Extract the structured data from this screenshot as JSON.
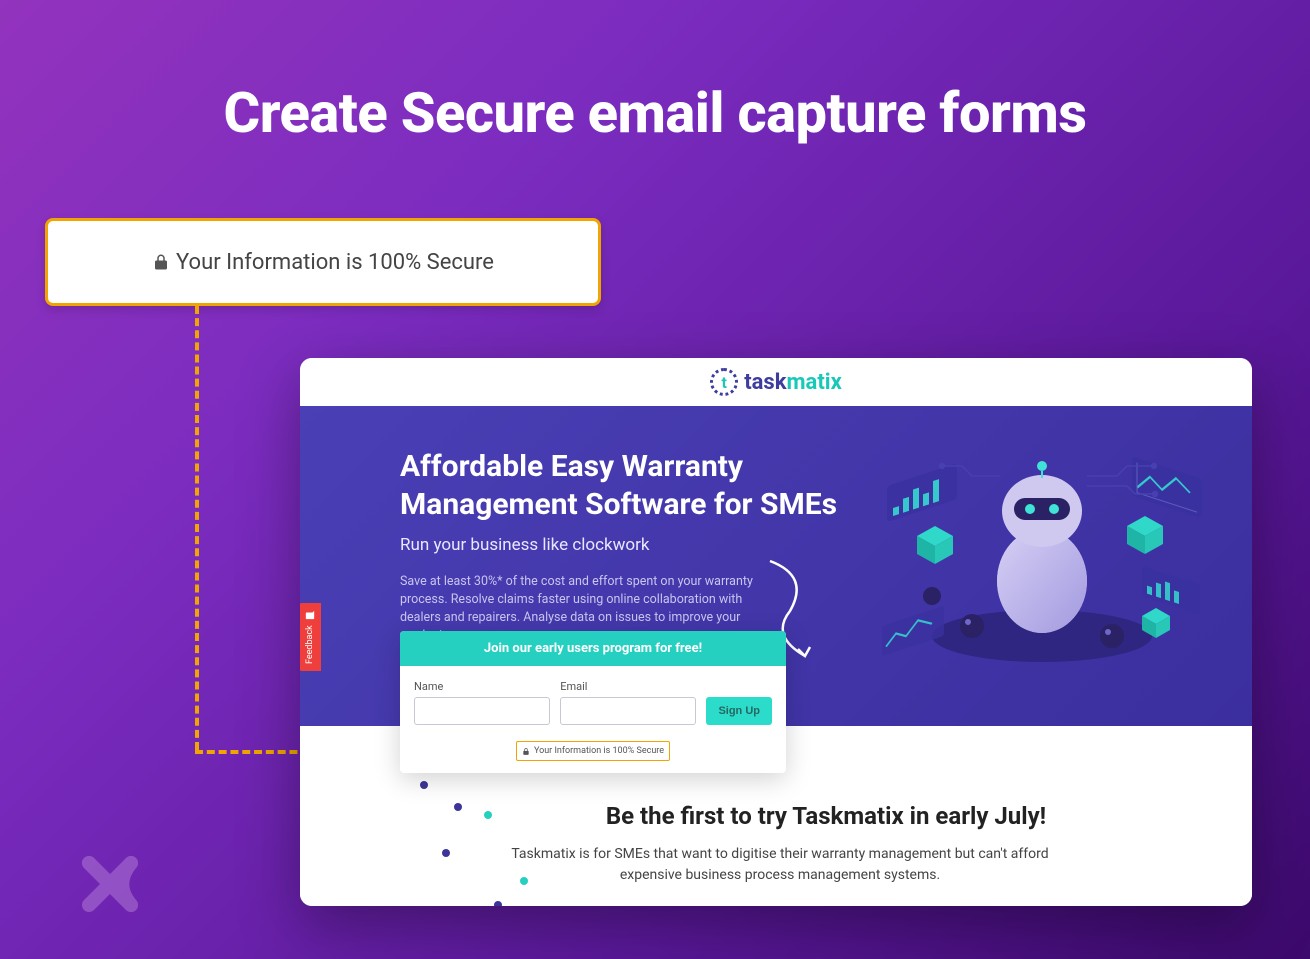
{
  "page": {
    "title": "Create Secure email capture forms"
  },
  "callout": {
    "text": "Your Information is 100% Secure"
  },
  "mock": {
    "brand_name_left": "task",
    "brand_name_right": "matix",
    "brand_glyph": "t",
    "feedback_label": "Feedback",
    "hero": {
      "title": "Affordable Easy Warranty Management Software for SMEs",
      "subtitle": "Run your business like clockwork",
      "description": "Save at least 30%* of the cost and effort spent on your warranty process. Resolve claims faster using online collaboration with dealers and repairers. Analyse data on issues to improve your product."
    },
    "form": {
      "banner": "Join our early users program for free!",
      "name_label": "Name",
      "email_label": "Email",
      "signup_label": "Sign Up",
      "secure_text": "Your Information is 100% Secure"
    },
    "below": {
      "title": "Be the first to try Taskmatix in early July!",
      "description": "Taskmatix is for SMEs that want to digitise their warranty management but can't afford expensive business process management systems."
    }
  },
  "colors": {
    "accent_orange": "#f0a500",
    "teal": "#25d0c0",
    "brand_indigo": "#3e3d9e"
  }
}
